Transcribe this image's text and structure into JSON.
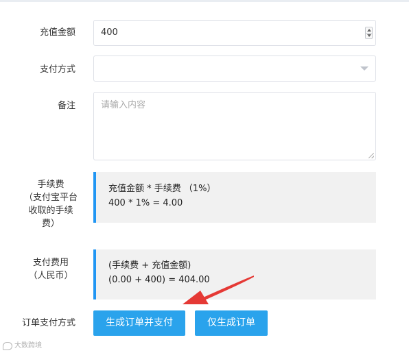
{
  "form": {
    "recharge_amount": {
      "label": "充值金额",
      "value": "400"
    },
    "payment_method": {
      "label": "支付方式",
      "value": ""
    },
    "remark": {
      "label": "备注",
      "placeholder": "请输入内容"
    },
    "fee": {
      "label_lines": [
        "手续费",
        "（支付宝平台",
        "收取的手续",
        "费）"
      ],
      "formula": "充值金额 * 手续费 （1%）",
      "calculation": "400 * 1% = 4.00"
    },
    "total": {
      "label_lines": [
        "支付费用",
        "（人民币）"
      ],
      "formula": "(手续费 + 充值金额)",
      "calculation": "(0.00 + 400) = 404.00"
    },
    "order_payment_method": {
      "label": "订单支付方式",
      "buttons": [
        "生成订单并支付",
        "仅生成订单"
      ]
    }
  },
  "watermark": "大数跨境",
  "colors": {
    "accent": "#2196f3",
    "button": "#2aa3ec",
    "arrow": "#e53935",
    "info_bg": "#f1f1f1"
  },
  "icons": [
    "spinner-icon",
    "chevron-down-icon",
    "resize-grip-icon",
    "annotation-arrow"
  ]
}
